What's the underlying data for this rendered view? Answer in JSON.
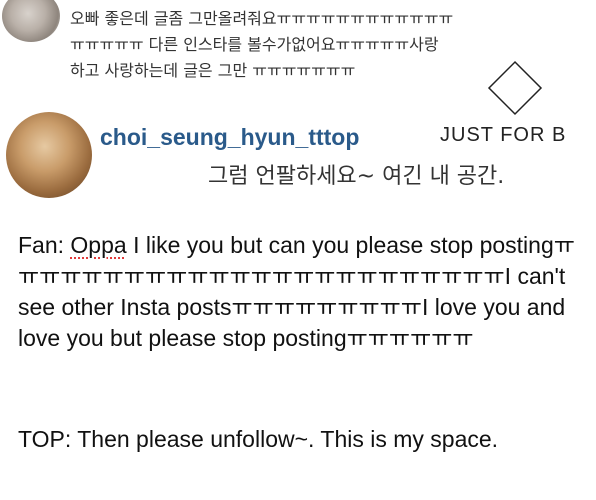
{
  "fan_comment": {
    "lines": [
      "오빠 좋은데 글좀 그만올려줘요ㅠㅠㅠㅠㅠㅠㅠㅠㅠㅠㅠㅠ",
      "ㅠㅠㅠㅠㅠ 다른 인스타를 볼수가없어요ㅠㅠㅠㅠㅠ사랑",
      "하고 사랑하는데 글은 그만 ㅠㅠㅠㅠㅠㅠㅠ"
    ]
  },
  "reply": {
    "username": "choi_seung_hyun_tttop",
    "text": "그럼 언팔하세요~ 여긴 내 공간."
  },
  "watermark": {
    "text": "JUST FOR B"
  },
  "translation": {
    "fan_prefix": "Fan: ",
    "fan_oppa": "Oppa",
    "fan_rest": " I like you but can you please stop postingㅠㅠㅠㅠㅠㅠㅠㅠㅠㅠㅠㅠㅠㅠㅠㅠㅠㅠㅠㅠㅠㅠㅠㅠI can't see other Insta postsㅠㅠㅠㅠㅠㅠㅠㅠㅠI love you and love you but please stop postingㅠㅠㅠㅠㅠㅠ",
    "top_text": "TOP: Then please unfollow~. This is my space."
  }
}
